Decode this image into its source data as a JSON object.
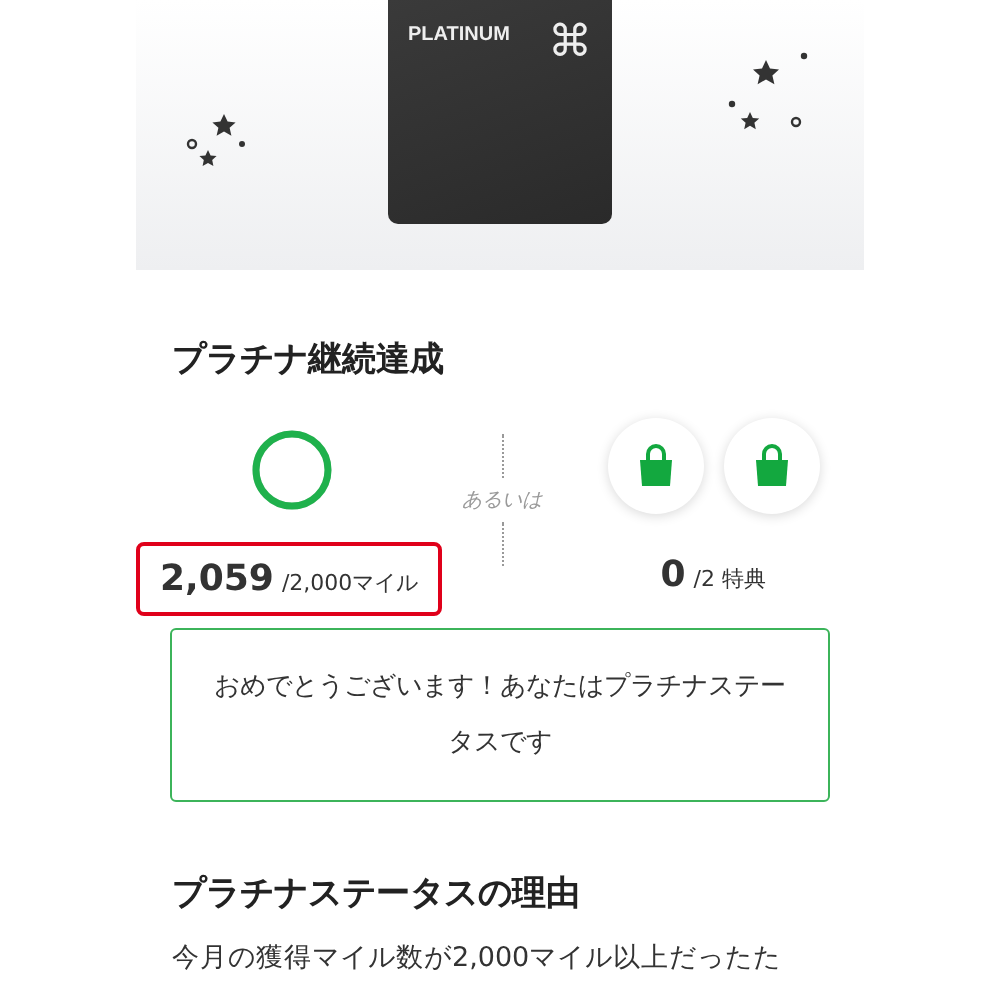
{
  "card": {
    "label": "PLATINUM",
    "symbol": "⌘"
  },
  "achievement": {
    "title": "プラチナ継続達成",
    "miles": {
      "value": "2,059",
      "target": "/2,000マイル",
      "level": 1,
      "highlighted": true
    },
    "separator": "あるいは",
    "benefits": {
      "value": "0",
      "target": "/2 特典",
      "bags": [
        {
          "earned": false
        },
        {
          "earned": false
        }
      ]
    },
    "message": "おめでとうございます！あなたはプラチナステータスです"
  },
  "reason": {
    "title": "プラチナステータスの理由",
    "text": "今月の獲得マイル数が2,000マイル以上だったた"
  }
}
